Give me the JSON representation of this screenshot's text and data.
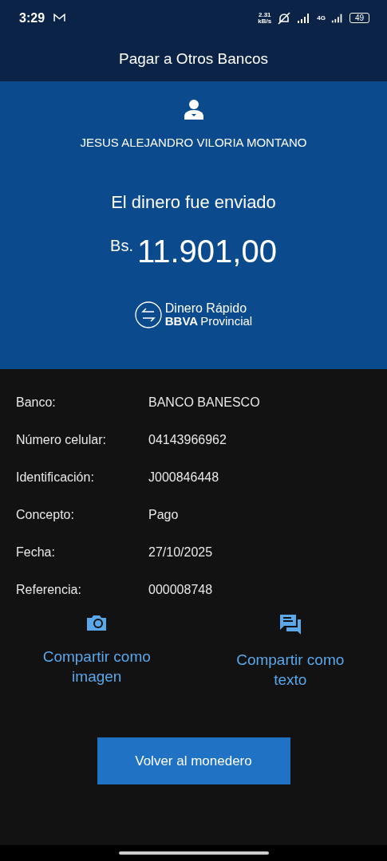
{
  "status_bar": {
    "time": "3:29",
    "speed_value": "2.31",
    "speed_unit": "kB/s",
    "network": "4G",
    "battery": "49"
  },
  "header": {
    "title": "Pagar a Otros Bancos"
  },
  "summary": {
    "recipient": "JESUS ALEJANDRO VILORIA MONTANO",
    "message": "El dinero fue enviado",
    "currency": "Bs.",
    "amount": "11.901,00",
    "brand_line_1": "Dinero Rápido",
    "brand_line_2_bold": "BBVA",
    "brand_line_2": "Provincial"
  },
  "details": [
    {
      "label": "Banco:",
      "value": "BANCO BANESCO"
    },
    {
      "label": "Número celular:",
      "value": "04143966962"
    },
    {
      "label": "Identificación:",
      "value": "J000846448"
    },
    {
      "label": "Concepto:",
      "value": "Pago"
    },
    {
      "label": "Fecha:",
      "value": "27/10/2025"
    },
    {
      "label": "Referencia:",
      "value": "000008748"
    }
  ],
  "share_actions": [
    {
      "kind": "image",
      "label": "Compartir como imagen"
    },
    {
      "kind": "text",
      "label": "Compartir como texto"
    }
  ],
  "primary_button": "Volver al monedero"
}
